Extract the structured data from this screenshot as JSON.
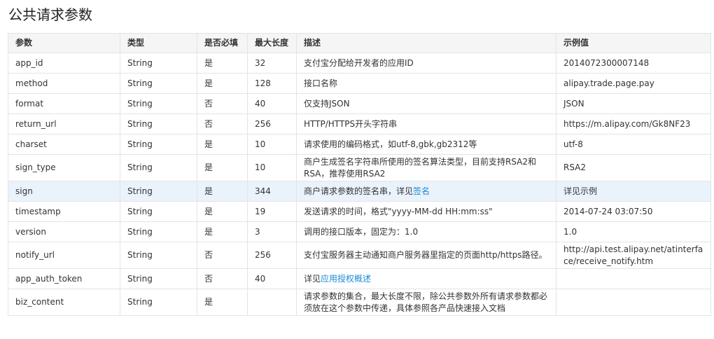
{
  "title": "公共请求参数",
  "columns": [
    "参数",
    "类型",
    "是否必填",
    "最大长度",
    "描述",
    "示例值"
  ],
  "rows": [
    {
      "name": "app_id",
      "type": "String",
      "required": "是",
      "maxlen": "32",
      "desc": "支付宝分配给开发者的应用ID",
      "example": "2014072300007148"
    },
    {
      "name": "method",
      "type": "String",
      "required": "是",
      "maxlen": "128",
      "desc": "接口名称",
      "example": "alipay.trade.page.pay"
    },
    {
      "name": "format",
      "type": "String",
      "required": "否",
      "maxlen": "40",
      "desc": "仅支持JSON",
      "example": "JSON"
    },
    {
      "name": "return_url",
      "type": "String",
      "required": "否",
      "maxlen": "256",
      "desc": "HTTP/HTTPS开头字符串",
      "example": "https://m.alipay.com/Gk8NF23"
    },
    {
      "name": "charset",
      "type": "String",
      "required": "是",
      "maxlen": "10",
      "desc": "请求使用的编码格式，如utf-8,gbk,gb2312等",
      "example": "utf-8"
    },
    {
      "name": "sign_type",
      "type": "String",
      "required": "是",
      "maxlen": "10",
      "desc": "商户生成签名字符串所使用的签名算法类型，目前支持RSA2和RSA，推荐使用RSA2",
      "example": "RSA2"
    },
    {
      "name": "sign",
      "type": "String",
      "required": "是",
      "maxlen": "344",
      "desc_prefix": "商户请求参数的签名串，详见",
      "desc_link": "签名",
      "example": "详见示例"
    },
    {
      "name": "timestamp",
      "type": "String",
      "required": "是",
      "maxlen": "19",
      "desc": "发送请求的时间，格式\"yyyy-MM-dd HH:mm:ss\"",
      "example": "2014-07-24 03:07:50"
    },
    {
      "name": "version",
      "type": "String",
      "required": "是",
      "maxlen": "3",
      "desc": "调用的接口版本，固定为：1.0",
      "example": "1.0"
    },
    {
      "name": "notify_url",
      "type": "String",
      "required": "否",
      "maxlen": "256",
      "desc": "支付宝服务器主动通知商户服务器里指定的页面http/https路径。",
      "example": "http://api.test.alipay.net/atinterface/receive_notify.htm"
    },
    {
      "name": "app_auth_token",
      "type": "String",
      "required": "否",
      "maxlen": "40",
      "desc_prefix": "详见",
      "desc_link": "应用授权概述",
      "example": ""
    },
    {
      "name": "biz_content",
      "type": "String",
      "required": "是",
      "maxlen": "",
      "desc": "请求参数的集合，最大长度不限，除公共参数外所有请求参数都必须放在这个参数中传递，具体参照各产品快速接入文档",
      "example": ""
    }
  ]
}
